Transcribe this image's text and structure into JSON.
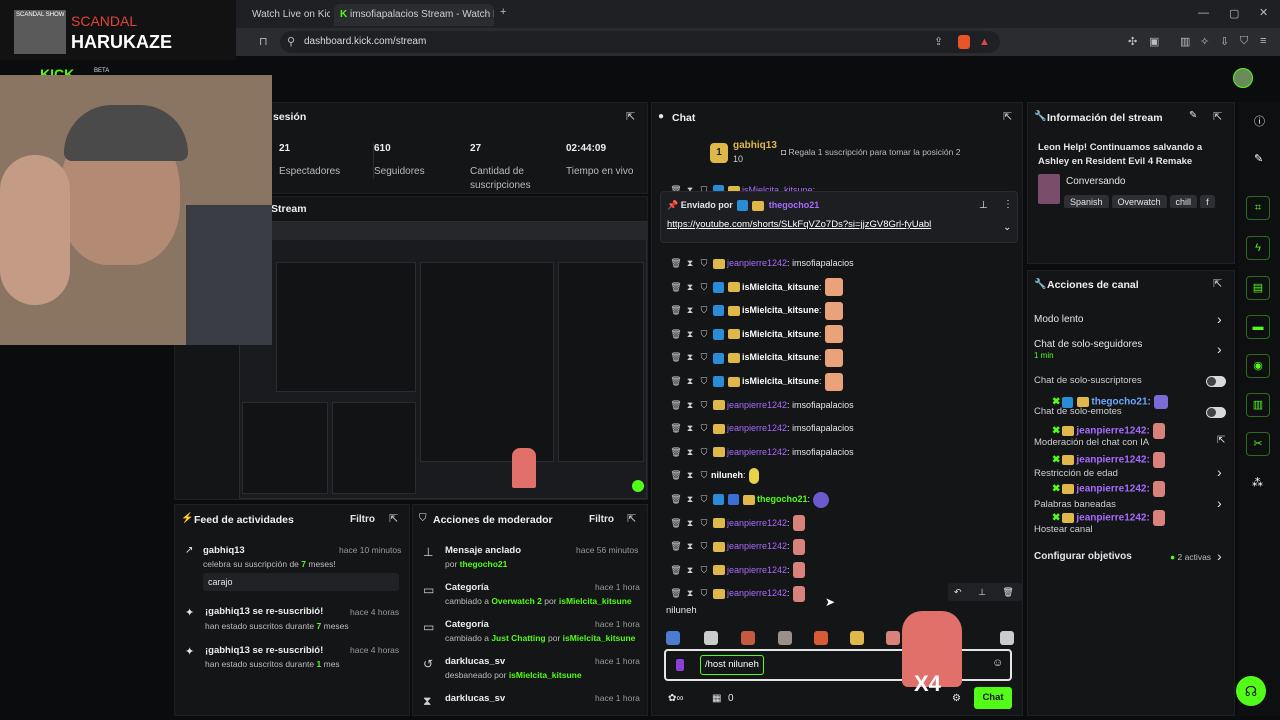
{
  "overlay": {
    "show": "SCANDAL SHOW",
    "scandal": "SCANDAL",
    "name": "HARUKAZE"
  },
  "browser": {
    "tabs": [
      "Watch Live on Kick",
      "imsofiapalacios Stream - Watch Live"
    ],
    "url": "dashboard.kick.com/stream",
    "new_tab": "+"
  },
  "header": {
    "beta": "BETA"
  },
  "session": {
    "title": "sesión",
    "stats": [
      {
        "value": "21",
        "label": "Espectadores"
      },
      {
        "value": "610",
        "label": "Seguidores"
      },
      {
        "value": "27",
        "label": "Cantidad de suscripciones"
      },
      {
        "value": "02:44:09",
        "label": "Tiempo en vivo"
      }
    ]
  },
  "stream_panel": {
    "title": "Stream"
  },
  "activity_feed": {
    "title": "Feed de actividades",
    "filter": "Filtro",
    "items": [
      {
        "title": "gabhiq13",
        "time": "hace 10 minutos",
        "sub_pre": "celebra su suscripción de ",
        "sub_num": "7",
        "sub_post": " meses!",
        "message": "carajo"
      },
      {
        "title": "¡gabhiq13 se re-suscribió!",
        "time": "hace 4 horas",
        "sub_pre": "han estado suscritos durante ",
        "sub_num": "7",
        "sub_post": " meses"
      },
      {
        "title": "¡gabhiq13 se re-suscribió!",
        "time": "hace 4 horas",
        "sub_pre": "han estado suscritos durante ",
        "sub_num": "1",
        "sub_post": " mes"
      }
    ]
  },
  "mod_actions": {
    "title": "Acciones de moderador",
    "filter": "Filtro",
    "items": [
      {
        "title": "Mensaje anclado",
        "time": "hace 56 minutos",
        "pre": "por ",
        "user": "thegocho21",
        "icon": "pin-icon"
      },
      {
        "title": "Categoría",
        "time": "hace 1 hora",
        "pre": "cambiado a ",
        "value": "Overwatch 2",
        "mid": " por ",
        "user": "isMielcita_kitsune",
        "icon": "category-icon"
      },
      {
        "title": "Categoría",
        "time": "hace 1 hora",
        "pre": "cambiado a ",
        "value": "Just Chatting",
        "mid": " por ",
        "user": "isMielcita_kitsune",
        "icon": "category-icon"
      },
      {
        "title": "darklucas_sv",
        "time": "hace 1 hora",
        "pre": "desbaneado por ",
        "user": "isMielcita_kitsune",
        "icon": "unban-icon"
      },
      {
        "title": "darklucas_sv",
        "time": "hace 1 hora",
        "pre": "",
        "user": "",
        "icon": "timeout-icon"
      }
    ]
  },
  "chat": {
    "title": "Chat",
    "top_gifter": {
      "rank": "1",
      "name": "gabhiq13",
      "count": "10",
      "cta": "Regala 1 suscripción para tomar la posición 2"
    },
    "partial_row_user": "isMielcita_kitsune:",
    "pinned": {
      "label": "Enviado por",
      "user": "thegocho21",
      "link": "https://youtube.com/shorts/SLkFqVZo7Ds?si=jjzGV8Grl-fyUabl"
    },
    "messages": [
      {
        "user": "jeanpierre1242",
        "sep": ": ",
        "text": "imsofiapalacios",
        "kind": "text"
      },
      {
        "user": "isMielcita_kitsune",
        "sep": ":",
        "text": "",
        "kind": "emote-blue"
      },
      {
        "user": "isMielcita_kitsune",
        "sep": ":",
        "text": "",
        "kind": "emote-blue"
      },
      {
        "user": "isMielcita_kitsune",
        "sep": ":",
        "text": "",
        "kind": "emote-blue"
      },
      {
        "user": "isMielcita_kitsune",
        "sep": ":",
        "text": "",
        "kind": "emote-blue"
      },
      {
        "user": "isMielcita_kitsune",
        "sep": ":",
        "text": "",
        "kind": "emote-blue"
      },
      {
        "user": "jeanpierre1242",
        "sep": ": ",
        "text": "imsofiapalacios",
        "kind": "text"
      },
      {
        "user": "jeanpierre1242",
        "sep": ": ",
        "text": "imsofiapalacios",
        "kind": "text"
      },
      {
        "user": "jeanpierre1242",
        "sep": ": ",
        "text": "imsofiapalacios",
        "kind": "text"
      },
      {
        "user": "niluneh",
        "sep": ":",
        "text": "",
        "kind": "emote-w"
      },
      {
        "user": "thegocho21",
        "sep": ":",
        "text": "",
        "kind": "emote-g"
      },
      {
        "user": "jeanpierre1242",
        "sep": ":",
        "text": "",
        "kind": "emote-p"
      },
      {
        "user": "jeanpierre1242",
        "sep": ":",
        "text": "",
        "kind": "emote-p"
      },
      {
        "user": "jeanpierre1242",
        "sep": ":",
        "text": "",
        "kind": "emote-p"
      },
      {
        "user": "jeanpierre1242",
        "sep": ":",
        "text": "",
        "kind": "emote-p"
      }
    ],
    "reply_user": "niluneh",
    "input_value": "/host niluneh",
    "points": "0",
    "send": "Chat",
    "sticker": "X4"
  },
  "stream_info": {
    "title": "Información del stream",
    "stream_title": "Leon Help! Continuamos salvando a Ashley en Resident Evil 4 Remake",
    "category": "Conversando",
    "tags": [
      "Spanish",
      "Overwatch",
      "chill",
      "f"
    ]
  },
  "channel_actions": {
    "title": "Acciones de canal",
    "items": [
      {
        "label": "Modo lento",
        "control": "chevron"
      },
      {
        "label": "Chat de solo-seguidores",
        "sub": "1 min",
        "control": "chevron"
      },
      {
        "label": "Chat de solo-suscriptores",
        "control": "toggle"
      },
      {
        "label": "Chat de solo-emotes",
        "control": "toggle"
      },
      {
        "label": "Moderación del chat con IA",
        "control": "external"
      },
      {
        "label": "Restricción de edad",
        "control": "chevron"
      },
      {
        "label": "Palabras baneadas",
        "control": "chevron"
      },
      {
        "label": "Hostear canal",
        "control": "none"
      }
    ],
    "goals": {
      "label": "Configurar objetivos",
      "status": "2 activas"
    }
  },
  "overlay_chat": [
    {
      "user": "thegocho21:"
    },
    {
      "user": "jeanpierre1242:"
    },
    {
      "user": "jeanpierre1242:"
    },
    {
      "user": "jeanpierre1242:"
    },
    {
      "user": "jeanpierre1242:"
    }
  ]
}
